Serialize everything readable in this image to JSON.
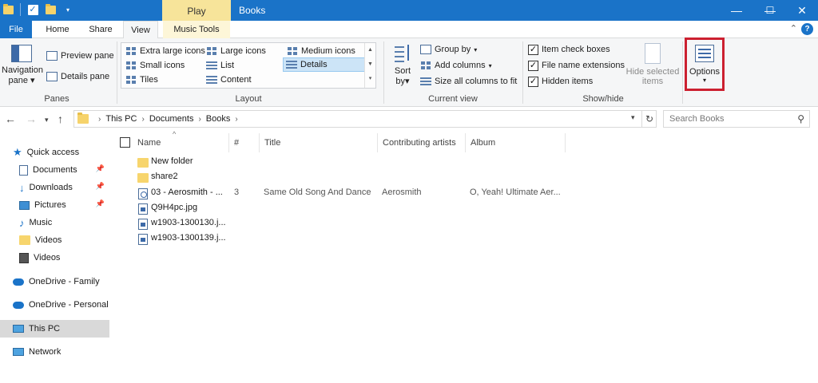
{
  "window": {
    "title": "Books",
    "contextual_tab": "Play",
    "minimize_glyph": "—",
    "maximize_glyph": "☐",
    "close_glyph": "✕"
  },
  "tabs": {
    "file": "File",
    "home": "Home",
    "share": "Share",
    "view": "View",
    "music_tools": "Music Tools"
  },
  "ribbon": {
    "panes": {
      "navigation_pane": "Navigation",
      "navigation_pane_2": "pane",
      "preview_pane": "Preview pane",
      "details_pane": "Details pane",
      "label": "Panes"
    },
    "layout": {
      "items": [
        "Extra large icons",
        "Large icons",
        "Medium icons",
        "Small icons",
        "List",
        "Details",
        "Tiles",
        "Content"
      ],
      "selected": "Details",
      "label": "Layout"
    },
    "current_view": {
      "sort_by": "Sort",
      "sort_by_2": "by",
      "group_by": "Group by",
      "add_columns": "Add columns",
      "size_all_columns": "Size all columns to fit",
      "label": "Current view"
    },
    "show_hide": {
      "item_check_boxes": "Item check boxes",
      "file_name_extensions": "File name extensions",
      "hidden_items": "Hidden items",
      "hide_selected_1": "Hide selected",
      "hide_selected_2": "items",
      "label": "Show/hide"
    },
    "options": "Options"
  },
  "address": {
    "crumbs": [
      "This PC",
      "Documents",
      "Books"
    ],
    "search_placeholder": "Search Books"
  },
  "nav_pane": {
    "items": [
      {
        "label": "Quick access",
        "icon": "star-icon"
      },
      {
        "label": "Documents",
        "icon": "documents-icon",
        "pinned": true
      },
      {
        "label": "Downloads",
        "icon": "download-icon",
        "pinned": true
      },
      {
        "label": "Pictures",
        "icon": "pictures-icon",
        "pinned": true
      },
      {
        "label": "Music",
        "icon": "music-icon"
      },
      {
        "label": "Videos",
        "icon": "folder-icon"
      },
      {
        "label": "Videos",
        "icon": "videos-icon"
      },
      {
        "label": "OneDrive - Family",
        "icon": "cloud-icon"
      },
      {
        "label": "OneDrive - Personal",
        "icon": "cloud-icon"
      },
      {
        "label": "This PC",
        "icon": "computer-icon",
        "selected": true
      },
      {
        "label": "Network",
        "icon": "network-icon"
      }
    ]
  },
  "file_list": {
    "columns": [
      "Name",
      "#",
      "Title",
      "Contributing artists",
      "Album"
    ],
    "rows": [
      {
        "name": "New folder",
        "type": "folder",
        "num": "",
        "title": "",
        "artists": "",
        "album": ""
      },
      {
        "name": "share2",
        "type": "folder",
        "num": "",
        "title": "",
        "artists": "",
        "album": ""
      },
      {
        "name": "03 - Aerosmith - ...",
        "type": "audio",
        "num": "3",
        "title": "Same Old Song And Dance",
        "artists": "Aerosmith",
        "album": "O, Yeah! Ultimate Aer..."
      },
      {
        "name": "Q9H4pc.jpg",
        "type": "image",
        "num": "",
        "title": "",
        "artists": "",
        "album": ""
      },
      {
        "name": "w1903-1300130.j...",
        "type": "image",
        "num": "",
        "title": "",
        "artists": "",
        "album": ""
      },
      {
        "name": "w1903-1300139.j...",
        "type": "image",
        "num": "",
        "title": "",
        "artists": "",
        "album": ""
      }
    ]
  },
  "colors": {
    "title_bar": "#1a73c8",
    "contextual_tab": "#f7e49a",
    "highlight_border": "#cc2030",
    "selection": "#cce4f7"
  }
}
